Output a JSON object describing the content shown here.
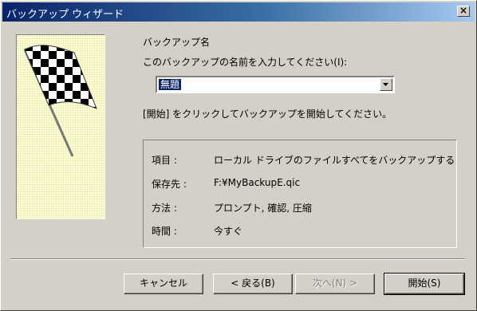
{
  "window": {
    "title": "バックアップ ウィザード",
    "close": "×"
  },
  "page": {
    "heading": "バックアップ名",
    "prompt": "このバックアップの名前を入力してください(I):",
    "name_value": "無題",
    "instruction": "[開始] をクリックしてバックアップを開始してください。"
  },
  "summary": {
    "rows": [
      {
        "label": "項目 :",
        "value": "ローカル ドライブのファイルすべてをバックアップする"
      },
      {
        "label": "保存先 :",
        "value": "F:¥MyBackupE.qic"
      },
      {
        "label": "方法 :",
        "value": "プロンプト, 確認, 圧縮"
      },
      {
        "label": "時間 :",
        "value": "今すぐ"
      }
    ]
  },
  "buttons": {
    "cancel": "キャンセル",
    "back": "< 戻る(B)",
    "next": "次へ(N) >",
    "start": "開始(S)"
  },
  "colors": {
    "title_start": "#0a246a",
    "title_end": "#a6caf0",
    "face": "#d4d0c8",
    "selection": "#0a246a"
  },
  "icons": {
    "graphic": "checkered-flag",
    "dropdown": "down-arrow"
  }
}
